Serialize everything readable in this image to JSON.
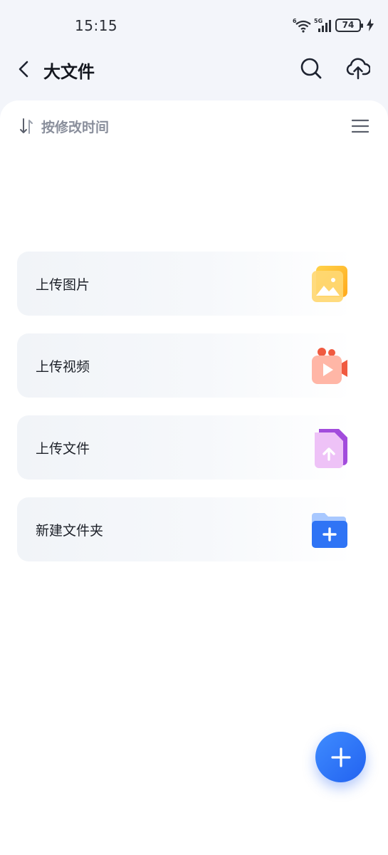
{
  "status_bar": {
    "time": "15:15",
    "wifi_badge": "6",
    "network_badge": "5G",
    "battery_level": "74",
    "icons": [
      "wifi-icon",
      "cellular-signal-icon",
      "battery-icon",
      "charging-bolt-icon"
    ]
  },
  "header": {
    "title": "大文件",
    "back_icon": "back-arrow-icon",
    "search_icon": "search-icon",
    "upload_icon": "cloud-upload-icon"
  },
  "toolbar": {
    "sort_label": "按修改时间",
    "sort_icon": "sort-arrows-icon",
    "view_icon": "list-menu-icon"
  },
  "actions": [
    {
      "label": "上传图片",
      "icon": "image-upload-icon"
    },
    {
      "label": "上传视频",
      "icon": "video-upload-icon"
    },
    {
      "label": "上传文件",
      "icon": "file-upload-icon"
    },
    {
      "label": "新建文件夹",
      "icon": "new-folder-icon"
    }
  ],
  "fab": {
    "icon": "plus-icon"
  },
  "colors": {
    "accent": "#2f6ff5",
    "background": "#f3f5fa",
    "card": "#f3f6f9",
    "image_icon": "#ffb72a",
    "video_icon": "#ff7a66",
    "file_icon": "#b24ee8",
    "folder_icon": "#2f74f5"
  }
}
